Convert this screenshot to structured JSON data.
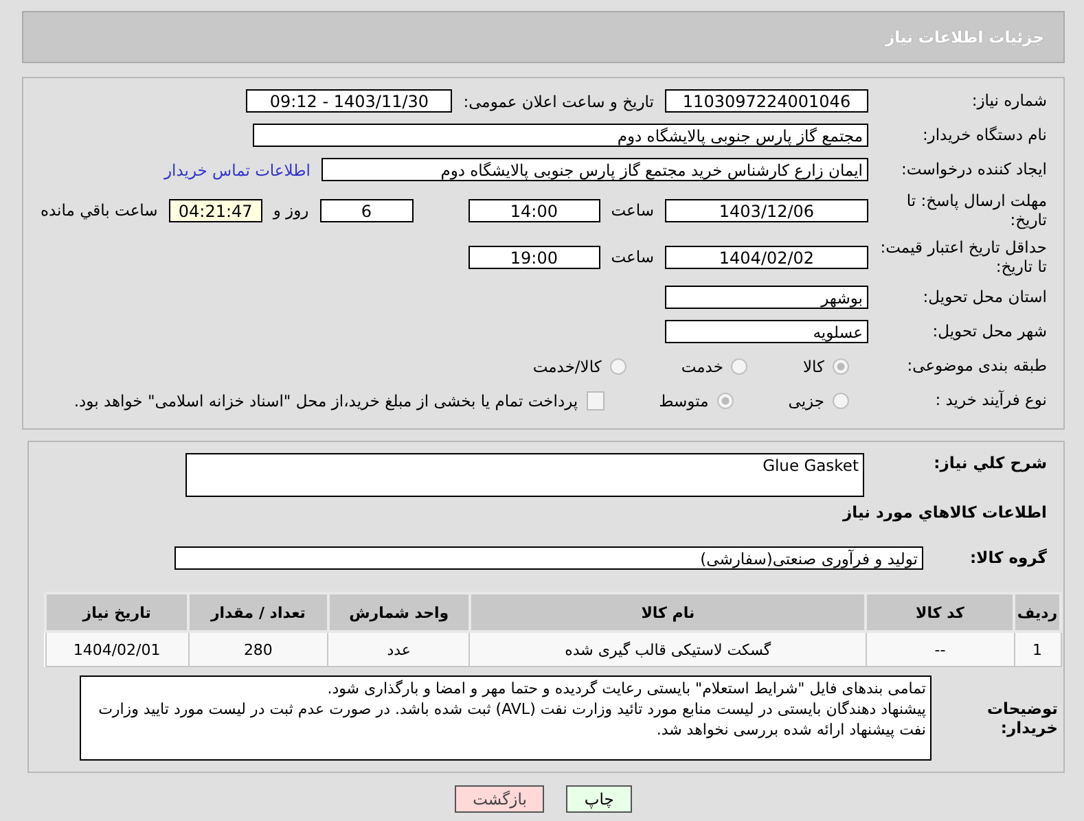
{
  "header": {
    "title": "جزئیات اطلاعات نیاز"
  },
  "details": {
    "need_number": {
      "label": "شماره نیاز:",
      "value": "1103097224001046"
    },
    "announce": {
      "label": "تاریخ و ساعت اعلان عمومی:",
      "value": "1403/11/30 - 09:12"
    },
    "buyer": {
      "label": "نام دستگاه خریدار:",
      "value": "مجتمع گاز پارس جنوبی  پالایشگاه دوم"
    },
    "creator": {
      "label": "ایجاد کننده درخواست:",
      "value": "ایمان زارع کارشناس خرید مجتمع گاز پارس جنوبی  پالایشگاه دوم",
      "link": "اطلاعات تماس خریدار"
    },
    "deadline": {
      "label": "مهلت ارسال پاسخ: تا تاریخ:",
      "date": "1403/12/06",
      "time_label": "ساعت",
      "time": "14:00",
      "days": "6",
      "days_label": "روز و",
      "remaining": "04:21:47",
      "remaining_label": "ساعت باقي مانده"
    },
    "validity": {
      "label": "حداقل تاریخ اعتبار قیمت: تا تاریخ:",
      "date": "1404/02/02",
      "time_label": "ساعت",
      "time": "19:00"
    },
    "province": {
      "label": "استان محل تحویل:",
      "value": "بوشهر"
    },
    "city": {
      "label": "شهر محل تحویل:",
      "value": "عسلویه"
    },
    "category": {
      "label": "طبقه بندی موضوعی:",
      "options": [
        {
          "label": "کالا",
          "selected": true
        },
        {
          "label": "خدمت",
          "selected": false
        },
        {
          "label": "کالا/خدمت",
          "selected": false
        }
      ]
    },
    "process": {
      "label": "نوع فرآیند خرید :",
      "options": [
        {
          "label": "جزیی",
          "selected": false
        },
        {
          "label": "متوسط",
          "selected": true
        }
      ],
      "payment": {
        "label": "پرداخت تمام یا بخشی از مبلغ خرید،از محل \"اسناد خزانه اسلامی\" خواهد بود.",
        "checked": false
      }
    }
  },
  "summary": {
    "label": "شرح كلي نياز:",
    "value": "Glue Gasket"
  },
  "goods": {
    "heading": "اطلاعات كالاهاي مورد نياز",
    "group_label": "گروه کالا:",
    "group": "تولید و فرآوری صنعتی(سفارشی)",
    "table": {
      "columns": [
        "ردیف",
        "کد کالا",
        "نام کالا",
        "واحد شمارش",
        "تعداد / مقدار",
        "تاریخ نیاز"
      ],
      "rows": [
        [
          "1",
          "--",
          "گسکت لاستیکی قالب گیری شده",
          "عدد",
          "280",
          "1404/02/01"
        ]
      ]
    }
  },
  "notes": {
    "label": "توضیحات خریدار:",
    "lines": [
      "تمامی بندهای فایل \"شرایط استعلام\" بایستی رعایت گردیده و حتما مهر و امضا و بارگذاری شود.",
      "پیشنهاد دهندگان بایستی در لیست منابع مورد تائید وزارت نفت (AVL)  ثبت شده باشد. در صورت عدم ثبت در لیست مورد تایید وزارت نفت پیشنهاد ارائه شده بررسی نخواهد شد."
    ]
  },
  "buttons": [
    {
      "kind": "print",
      "label": "چاپ"
    },
    {
      "kind": "back",
      "label": "بازگشت"
    }
  ]
}
